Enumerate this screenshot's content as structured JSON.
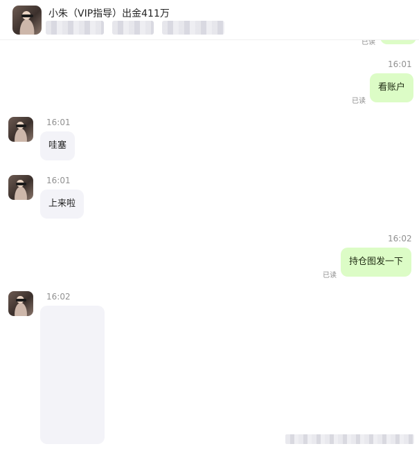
{
  "header": {
    "title": "小朱（VIP指导）出金411万"
  },
  "messages": [
    {
      "side": "out",
      "time": "",
      "text": "",
      "read": "已读"
    },
    {
      "side": "out",
      "time": "16:01",
      "text": "看账户",
      "read": "已读"
    },
    {
      "side": "in",
      "time": "16:01",
      "text": "哇塞"
    },
    {
      "side": "in",
      "time": "16:01",
      "text": "上来啦"
    },
    {
      "side": "out",
      "time": "16:02",
      "text": "持仓图发一下",
      "read": "已读"
    },
    {
      "side": "in",
      "time": "16:02",
      "text": "",
      "kind": "image"
    }
  ]
}
